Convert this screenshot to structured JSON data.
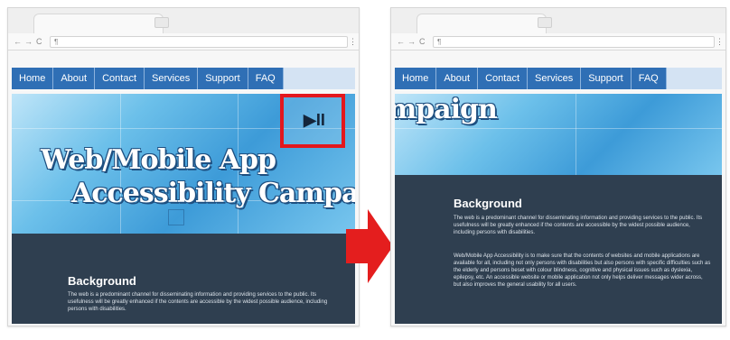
{
  "nav": {
    "items": [
      "Home",
      "About",
      "Contact",
      "Services",
      "Support",
      "FAQ"
    ]
  },
  "browser": {
    "back_icon": "←",
    "forward_icon": "→",
    "reload_icon": "C",
    "url_icon": "¶",
    "menu_icon": "⋮"
  },
  "hero": {
    "title_line1": "Web/Mobile App",
    "title_line2": "Accessibility Campaign",
    "title_cropped": "ampaign",
    "play_pause_glyph": "▶II"
  },
  "content": {
    "heading": "Background",
    "paragraph1": "The web is a predominant channel for disseminating information and providing services to the public. Its usefulness will be greatly enhanced if the contents are accessible by the widest possible audience, including persons with disabilities.",
    "paragraph2": "Web/Mobile App Accessibility is to make sure that the contents of websites and mobile applications are available for all, including not only persons with disabilities but also persons with specific difficulties such as the elderly and persons beset with colour blindness, cognitive and physical issues such as dyslexia, epilepsy, etc. An accessible website or mobile application not only helps deliver messages wider across, but also improves the general usability for all users."
  },
  "colors": {
    "highlight_box": "#e3171d",
    "arrow": "#e41e1e",
    "nav_bar": "#2f6fb5",
    "content_bg": "#2f3f50"
  }
}
